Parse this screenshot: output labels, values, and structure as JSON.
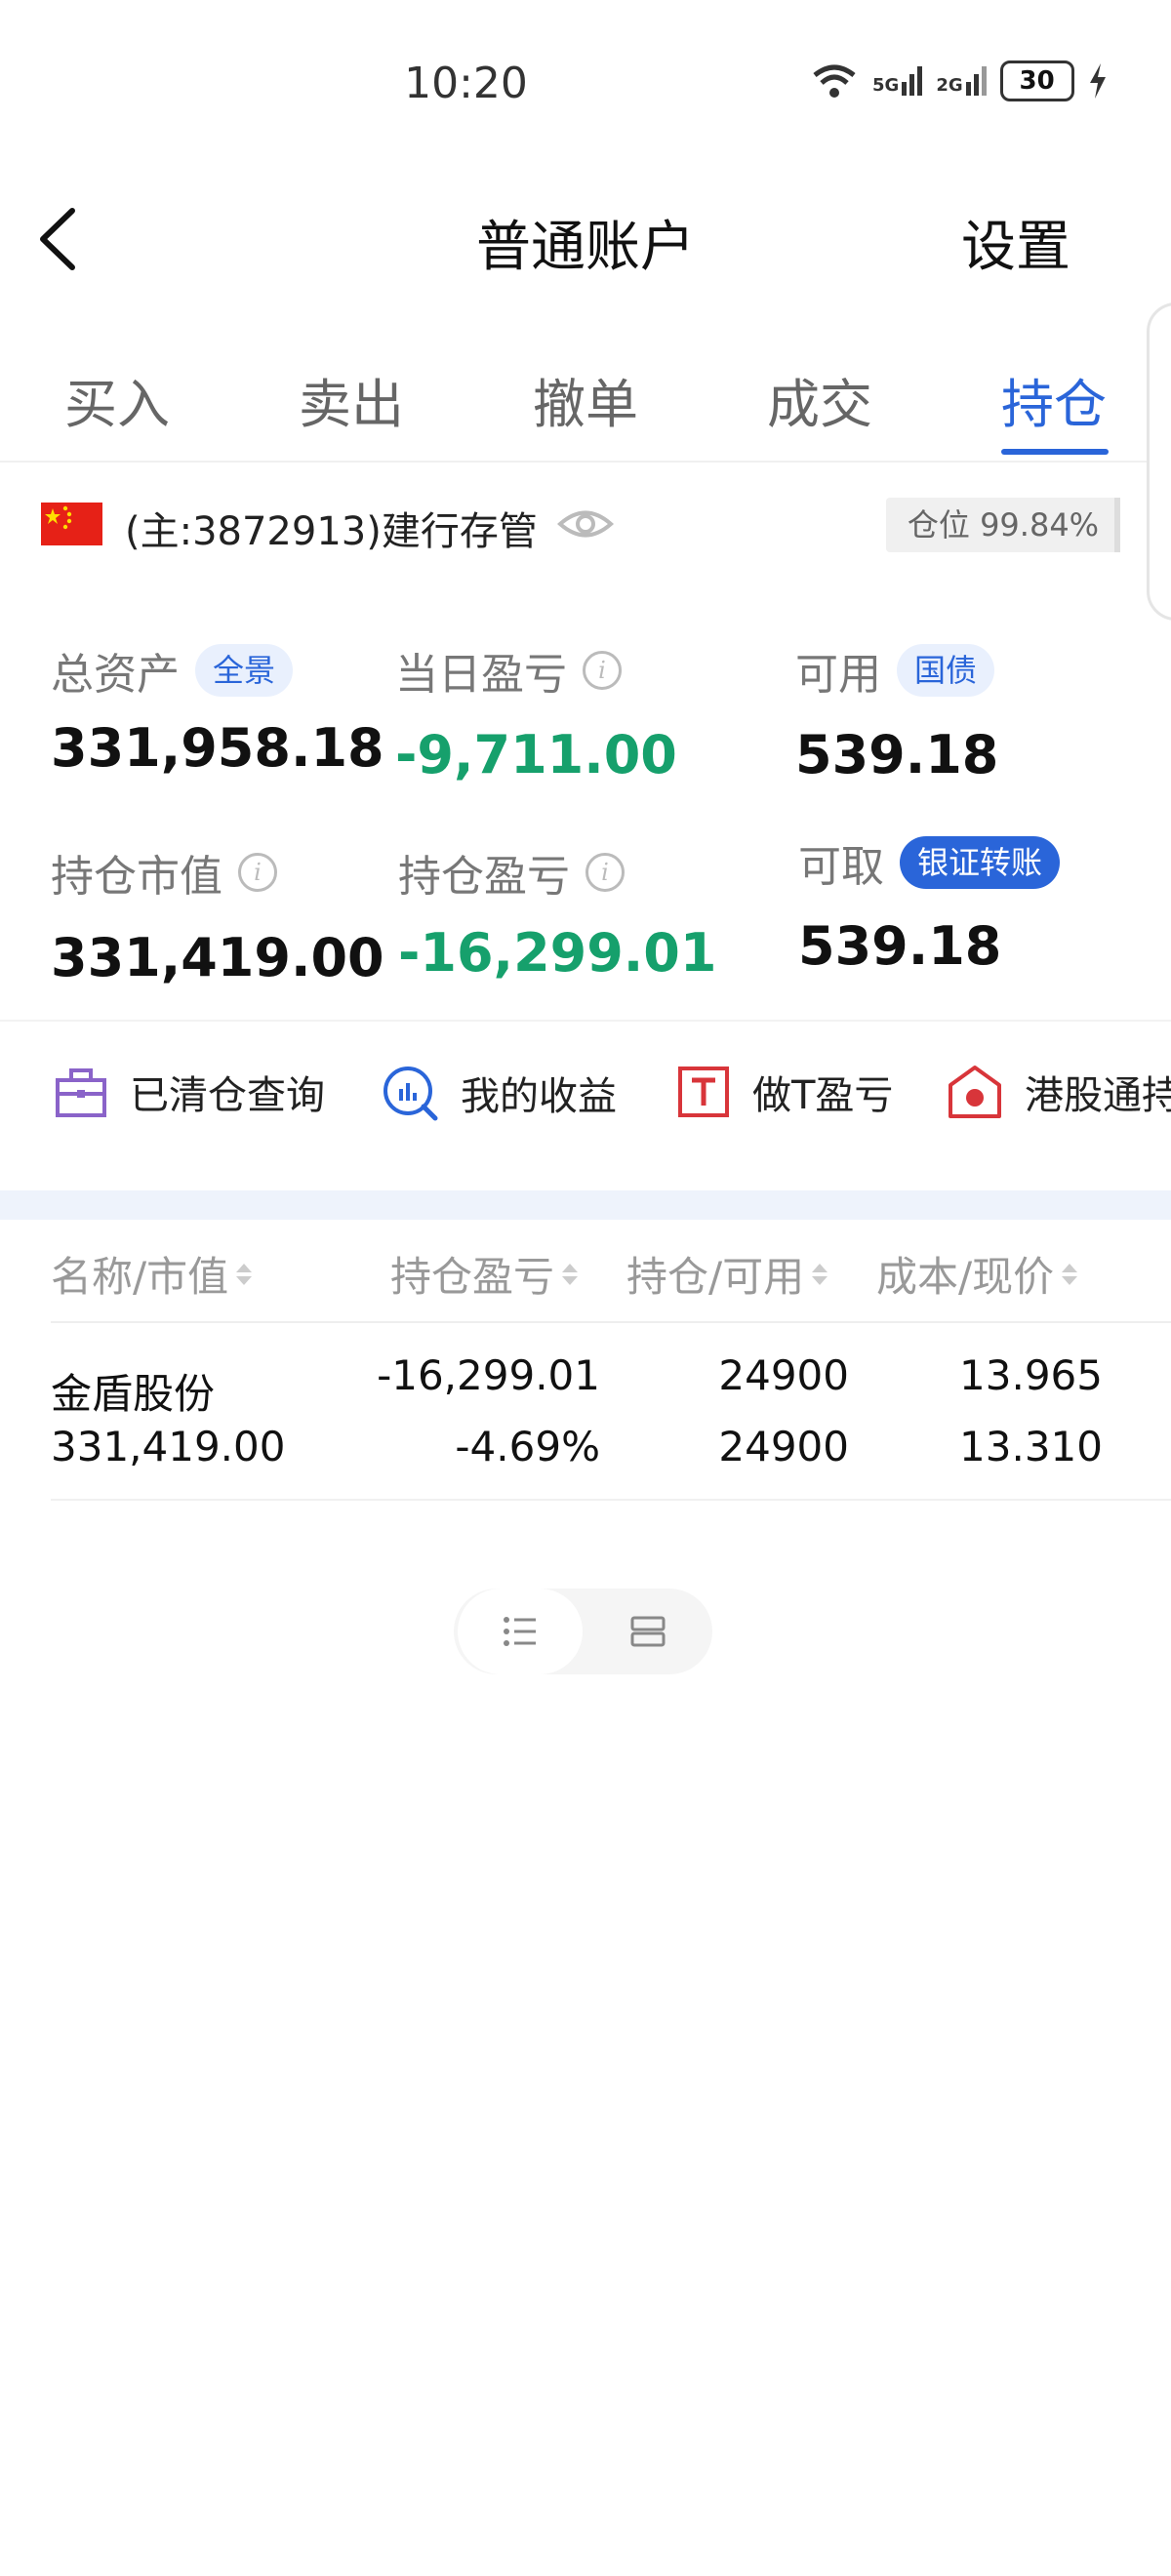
{
  "status_bar": {
    "time": "10:20",
    "battery": "30",
    "network_1": "5G",
    "network_2": "2G"
  },
  "nav": {
    "title": "普通账户",
    "settings_label": "设置"
  },
  "tabs": [
    {
      "label": "买入"
    },
    {
      "label": "卖出"
    },
    {
      "label": "撤单"
    },
    {
      "label": "成交"
    },
    {
      "label": "持仓",
      "active": true
    }
  ],
  "account": {
    "label": "(主:3872913)建行存管",
    "position_ratio": "仓位 99.84%"
  },
  "stats": {
    "total_assets": {
      "label": "总资产",
      "badge": "全景",
      "value": "331,958.18"
    },
    "daily_pnl": {
      "label": "当日盈亏",
      "value": "-9,711.00"
    },
    "available": {
      "label": "可用",
      "badge": "国债",
      "value": "539.18"
    },
    "holding_value": {
      "label": "持仓市值",
      "value": "331,419.00"
    },
    "holding_pnl": {
      "label": "持仓盈亏",
      "value": "-16,299.01"
    },
    "withdrawable": {
      "label": "可取",
      "badge": "银证转账",
      "value": "539.18"
    }
  },
  "quick_links": [
    {
      "label": "已清仓查询",
      "icon": "briefcase-icon"
    },
    {
      "label": "我的收益",
      "icon": "chart-search-icon"
    },
    {
      "label": "做T盈亏",
      "icon": "t-box-icon"
    },
    {
      "label": "港股通持",
      "icon": "hk-house-icon"
    }
  ],
  "table": {
    "headers": [
      "名称/市值",
      "持仓盈亏",
      "持仓/可用",
      "成本/现价"
    ],
    "rows": [
      {
        "name": "金盾股份",
        "market_value": "331,419.00",
        "pnl": "-16,299.01",
        "pnl_pct": "-4.69%",
        "holding": "24900",
        "available": "24900",
        "cost": "13.965",
        "price": "13.310"
      }
    ]
  },
  "colors": {
    "accent": "#2a65d9",
    "loss_green": "#16a06c"
  }
}
